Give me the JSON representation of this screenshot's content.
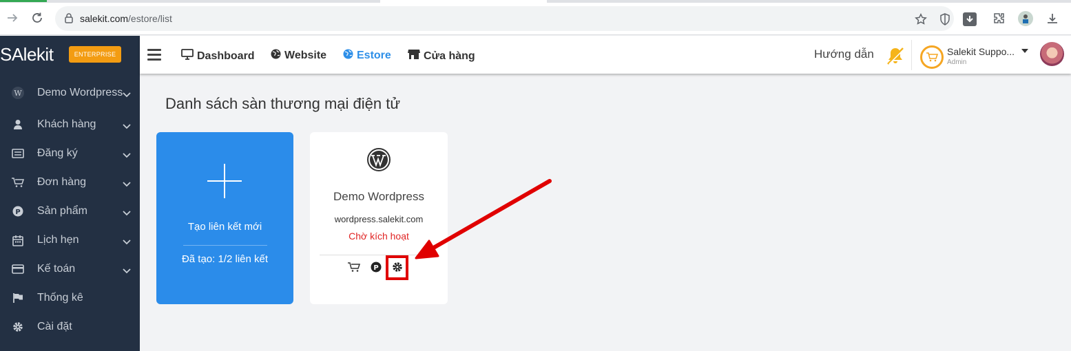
{
  "browser": {
    "url_host": "salekit.com",
    "url_path": "/estore/list"
  },
  "brand": {
    "logo_text": "SAlekit",
    "badge": "ENTERPRISE"
  },
  "topnav": {
    "items": [
      {
        "label": "Dashboard",
        "icon": "monitor-icon"
      },
      {
        "label": "Website",
        "icon": "globe-icon"
      },
      {
        "label": "Estore",
        "icon": "globe-icon",
        "active": true
      },
      {
        "label": "Cửa hàng",
        "icon": "store-icon"
      }
    ],
    "help": "Hướng dẫn",
    "user_name": "Salekit Suppo...",
    "user_role": "Admin"
  },
  "sidebar": {
    "items": [
      {
        "label": "Demo Wordpress",
        "icon": "wordpress-icon",
        "has_children": true
      },
      {
        "label": "Khách hàng",
        "icon": "user-icon",
        "has_children": true
      },
      {
        "label": "Đăng ký",
        "icon": "list-icon",
        "has_children": true
      },
      {
        "label": "Đơn hàng",
        "icon": "cart-icon",
        "has_children": true
      },
      {
        "label": "Sản phẩm",
        "icon": "product-icon",
        "has_children": true
      },
      {
        "label": "Lịch hẹn",
        "icon": "calendar-icon",
        "has_children": true
      },
      {
        "label": "Kế toán",
        "icon": "card-icon",
        "has_children": true
      },
      {
        "label": "Thống kê",
        "icon": "flag-icon",
        "has_children": false
      },
      {
        "label": "Cài đặt",
        "icon": "gear-icon",
        "has_children": false
      }
    ]
  },
  "main": {
    "title": "Danh sách sàn thương mại điện tử",
    "new_card": {
      "title": "Tạo liên kết mới",
      "count": "Đã tạo: 1/2 liên kết"
    },
    "store_card": {
      "name": "Demo Wordpress",
      "domain": "wordpress.salekit.com",
      "status": "Chờ kích hoạt"
    }
  },
  "colors": {
    "sidebar_bg": "#233043",
    "accent_blue": "#2b8cea",
    "badge_orange": "#f39c12",
    "status_red": "#e02424",
    "annotation_red": "#e00000"
  }
}
